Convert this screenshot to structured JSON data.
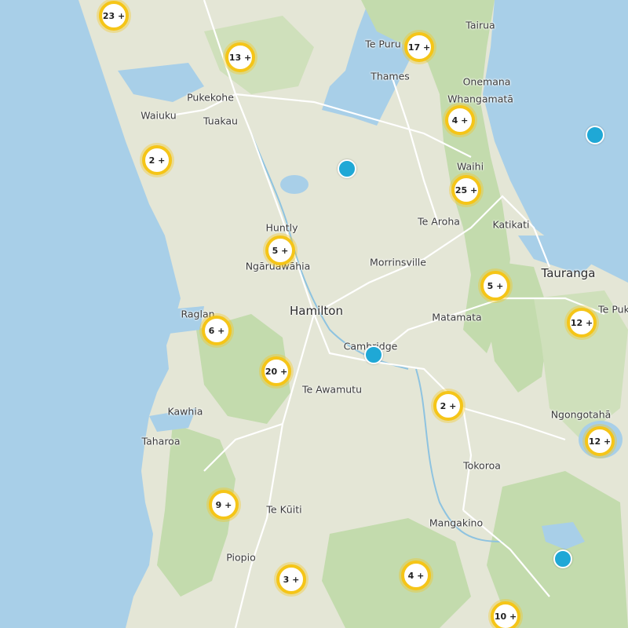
{
  "colors": {
    "sea": "#a8cfe8",
    "land": "#e4e6d6",
    "forest": "#c3dbad",
    "cluster_ring": "#f5c518",
    "marker": "#1fa8d6"
  },
  "places": {
    "te_puru": "Te Puru",
    "tairua": "Tairua",
    "thames": "Thames",
    "onemana": "Onemana",
    "whangamata": "Whangamatā",
    "pukekohe": "Pukekohe",
    "waiuku": "Waiuku",
    "tuakau": "Tuakau",
    "waihi": "Waihi",
    "te_aroha": "Te Aroha",
    "katikati": "Katikati",
    "huntly": "Huntly",
    "ngaruawahia": "Ngāruawāhia",
    "morrinsville": "Morrinsville",
    "tauranga": "Tauranga",
    "raglan": "Raglan",
    "hamilton": "Hamilton",
    "matamata": "Matamata",
    "te_puke": "Te Puk",
    "cambridge": "Cambridge",
    "te_awamutu": "Te Awamutu",
    "kawhia": "Kawhia",
    "ngongotaha": "Ngongotahā",
    "taharoa": "Taharoa",
    "tokoroa": "Tokoroa",
    "te_kuiti": "Te Kūiti",
    "mangakino": "Mangakino",
    "piopio": "Piopio"
  },
  "clusters": [
    {
      "label": "23 +"
    },
    {
      "label": "13 +"
    },
    {
      "label": "17 +"
    },
    {
      "label": "4 +"
    },
    {
      "label": "2 +"
    },
    {
      "label": "25 +"
    },
    {
      "label": "5 +"
    },
    {
      "label": "5 +"
    },
    {
      "label": "6 +"
    },
    {
      "label": "12 +"
    },
    {
      "label": "20 +"
    },
    {
      "label": "2 +"
    },
    {
      "label": "12 +"
    },
    {
      "label": "9 +"
    },
    {
      "label": "3 +"
    },
    {
      "label": "4 +"
    },
    {
      "label": "10 +"
    }
  ]
}
